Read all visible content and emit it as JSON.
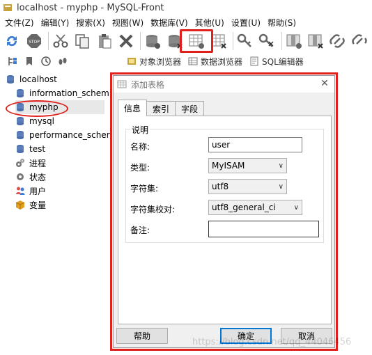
{
  "window": {
    "title": "localhost - myphp - MySQL-Front"
  },
  "menu": [
    "文件(Z)",
    "编辑(Y)",
    "搜索(X)",
    "视图(W)",
    "数据库(V)",
    "其他(U)",
    "设置(U)",
    "帮助(S)"
  ],
  "toolbar2": {
    "object_browser": "对象浏览器",
    "data_browser": "数据浏览器",
    "sql_editor": "SQL编辑器"
  },
  "tree": {
    "root": "localhost",
    "databases": [
      "information_schem",
      "myphp",
      "mysql",
      "performance_scher",
      "test"
    ],
    "others": [
      "进程",
      "状态",
      "用户",
      "变量"
    ]
  },
  "dialog": {
    "title": "添加表格",
    "close": "✕",
    "tabs": [
      "信息",
      "索引",
      "字段"
    ],
    "group_label": "说明",
    "fields": {
      "name_label": "名称:",
      "name_value": "user",
      "type_label": "类型:",
      "type_value": "MyISAM",
      "charset_label": "字符集:",
      "charset_value": "utf8",
      "collation_label": "字符集校对:",
      "collation_value": "utf8_general_ci",
      "comment_label": "备注:",
      "comment_value": ""
    },
    "buttons": {
      "help": "帮助",
      "ok": "确定",
      "cancel": "取消"
    }
  },
  "watermark": "https://blog.csdn.net/qq_44046456",
  "colors": {
    "annotation": "#e0201c",
    "db_icon": "#4a6ea8",
    "default_button_border": "#0078d7"
  }
}
